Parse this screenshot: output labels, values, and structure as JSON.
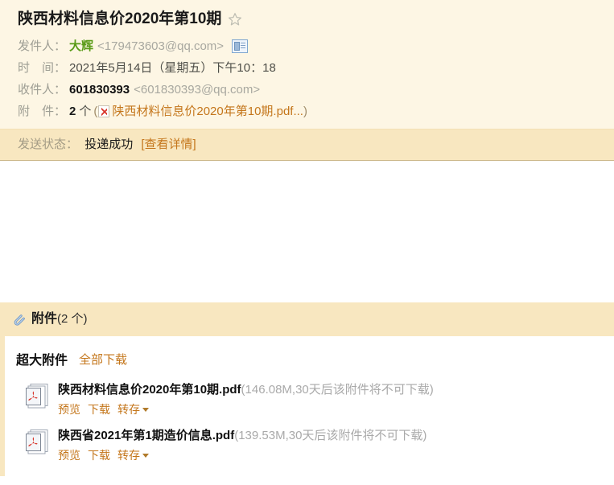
{
  "mail": {
    "subject": "陕西材料信息价2020年第10期",
    "star_icon": "star-outline-icon",
    "sender": {
      "label": "发件人：",
      "name": "大辉",
      "address": "<179473603@qq.com>",
      "card_icon": "contact-card-icon"
    },
    "time": {
      "label": "时　间：",
      "value": "2021年5月14日（星期五）下午10：18"
    },
    "recipient": {
      "label": "收件人：",
      "name": "601830393",
      "address": "<601830393@qq.com>"
    },
    "attachment_summary": {
      "label": "附　件：",
      "count": "2",
      "unit": "个",
      "open_paren": "(",
      "file_icon": "pdf-file-icon",
      "first_file": "陕西材料信息价2020年第10期.pdf...",
      "close_paren": ")"
    }
  },
  "send_status": {
    "label": "发送状态：",
    "value": "投递成功",
    "detail_link": "[查看详情]"
  },
  "attachment_panel": {
    "clip_icon": "paperclip-icon",
    "title": "附件",
    "count_text": "(2 个)",
    "bigfile_label": "超大附件",
    "download_all": "全部下载",
    "items": [
      {
        "icon": "pdf-file-icon",
        "filename": "陕西材料信息价2020年第10期.pdf",
        "meta": "(146.08M,30天后该附件将不可下载)",
        "actions": [
          "预览",
          "下载",
          "转存"
        ],
        "dropdown_icon": "chevron-down-icon"
      },
      {
        "icon": "pdf-file-icon",
        "filename": "陕西省2021年第1期造价信息.pdf",
        "meta": "(139.53M,30天后该附件将不可下载)",
        "actions": [
          "预览",
          "下载",
          "转存"
        ],
        "dropdown_icon": "chevron-down-icon"
      }
    ]
  },
  "colors": {
    "header_bg": "#fdf6e4",
    "band_bg": "#f8e7c0",
    "link_orange": "#c4761b",
    "sender_green": "#5a9b18",
    "meta_gray": "#a9a9a9"
  }
}
